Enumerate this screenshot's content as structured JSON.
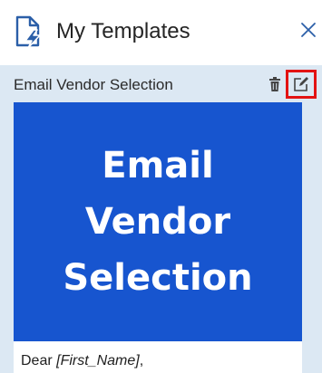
{
  "header": {
    "title": "My Templates",
    "icon": "template-document-lightning-icon",
    "close_icon": "close-icon"
  },
  "template": {
    "title": "Email Vendor Selection",
    "delete_icon": "trash-icon",
    "edit_icon": "edit-icon",
    "preview_lines": [
      "Email",
      "Vendor",
      "Selection"
    ],
    "greeting_prefix": "Dear ",
    "greeting_placeholder": "[First_Name]",
    "greeting_suffix": ","
  },
  "colors": {
    "accent": "#2b5fa8",
    "list_background": "#dce8f3",
    "preview_background": "#1755cf",
    "highlight": "#e31212"
  }
}
